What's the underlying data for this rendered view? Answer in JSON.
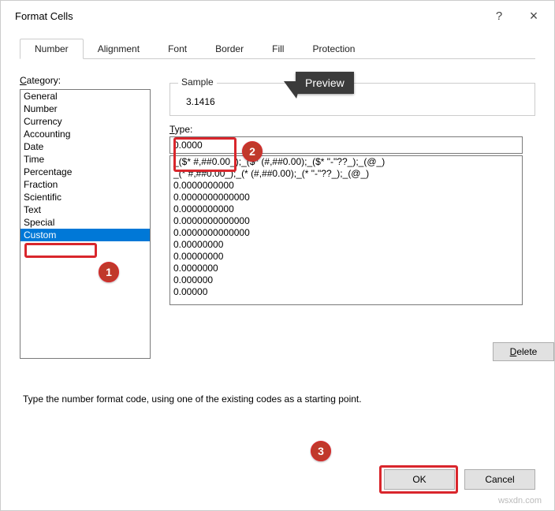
{
  "window": {
    "title": "Format Cells",
    "help": "?",
    "close": "×"
  },
  "tabs": {
    "items": [
      "Number",
      "Alignment",
      "Font",
      "Border",
      "Fill",
      "Protection"
    ],
    "active": "Number"
  },
  "category": {
    "label": "Category:",
    "items": [
      "General",
      "Number",
      "Currency",
      "Accounting",
      "Date",
      "Time",
      "Percentage",
      "Fraction",
      "Scientific",
      "Text",
      "Special",
      "Custom"
    ],
    "selected": "Custom"
  },
  "sample": {
    "label": "Sample",
    "value": "3.1416"
  },
  "type": {
    "label": "Type:",
    "value": "0.0000",
    "formats": [
      "_($* #,##0.00_);_($* (#,##0.00);_($* \"-\"??_);_(@_)",
      "_(* #,##0.00_);_(* (#,##0.00);_(* \"-\"??_);_(@_)",
      "0.0000000000",
      "0.0000000000000",
      "0.0000000000",
      "0.0000000000000",
      "0.0000000000000",
      "0.00000000",
      "0.00000000",
      "0.0000000",
      "0.000000",
      "0.00000"
    ]
  },
  "buttons": {
    "delete": "Delete",
    "ok": "OK",
    "cancel": "Cancel"
  },
  "hint": "Type the number format code, using one of the existing codes as a starting point.",
  "annotations": {
    "preview": "Preview",
    "badge1": "1",
    "badge2": "2",
    "badge3": "3"
  },
  "watermark": "wsxdn.com"
}
